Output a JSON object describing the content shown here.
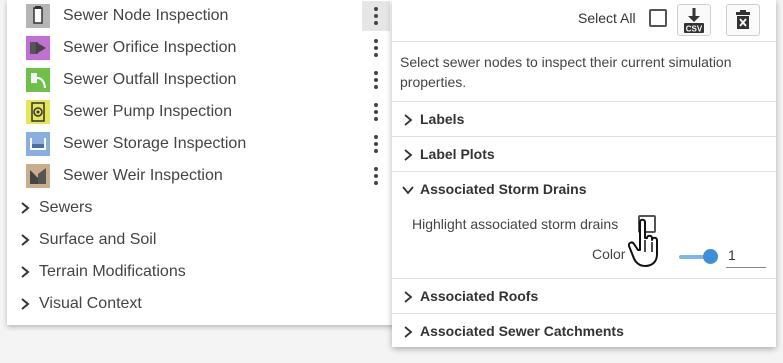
{
  "left_panel": {
    "inspections": [
      {
        "label": "Sewer Node Inspection",
        "icon": "sewer-node-icon",
        "color": "#b5b5b5",
        "active": true
      },
      {
        "label": "Sewer Orifice Inspection",
        "icon": "sewer-orifice-icon",
        "color": "#c070d0",
        "active": false
      },
      {
        "label": "Sewer Outfall Inspection",
        "icon": "sewer-outfall-icon",
        "color": "#6ec04a",
        "active": false
      },
      {
        "label": "Sewer Pump Inspection",
        "icon": "sewer-pump-icon",
        "color": "#e6e65a",
        "active": false
      },
      {
        "label": "Sewer Storage Inspection",
        "icon": "sewer-storage-icon",
        "color": "#8aaee0",
        "active": false
      },
      {
        "label": "Sewer Weir Inspection",
        "icon": "sewer-weir-icon",
        "color": "#c9ad8c",
        "active": false
      }
    ],
    "groups": [
      {
        "label": "Sewers"
      },
      {
        "label": "Surface and Soil"
      },
      {
        "label": "Terrain Modifications"
      },
      {
        "label": "Visual Context"
      }
    ]
  },
  "right_panel": {
    "select_all_label": "Select All",
    "csv_label": "CSV",
    "description": "Select sewer nodes to inspect their current simulation properties.",
    "sections": [
      {
        "label": "Labels",
        "expanded": false
      },
      {
        "label": "Label Plots",
        "expanded": false
      },
      {
        "label": "Associated Storm Drains",
        "expanded": true
      },
      {
        "label": "Associated Roofs",
        "expanded": false
      },
      {
        "label": "Associated Sewer Catchments",
        "expanded": false
      }
    ],
    "storm_drains": {
      "highlight_label": "Highlight associated storm drains",
      "color_label": "Color",
      "color_value": "1",
      "slider_color": "#3d8fd9"
    }
  }
}
